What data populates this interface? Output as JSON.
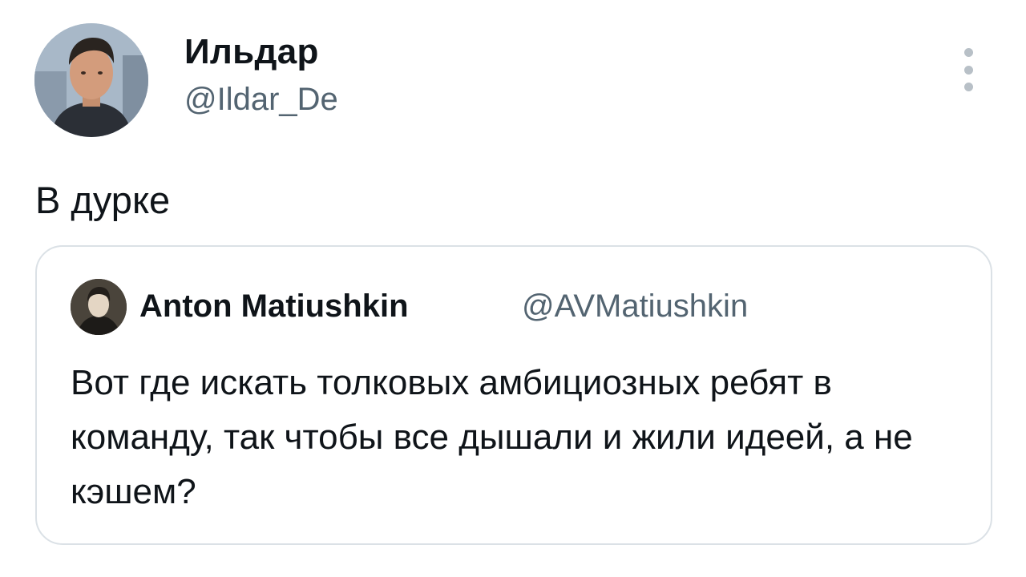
{
  "tweet": {
    "author": {
      "name": "Ильдар",
      "handle": "@Ildar_De"
    },
    "text": "В дурке",
    "more_icon": "more-vertical-icon"
  },
  "quoted_tweet": {
    "author": {
      "name": "Anton Matiushkin",
      "handle": "@AVMatiushkin"
    },
    "text": "Вот где искать толковых амбициозных ребят в команду, так чтобы все дышали и жили идеей, а не кэшем?"
  },
  "colors": {
    "text_primary": "#0f1419",
    "text_secondary": "#536471",
    "border": "#dbe1e6",
    "background": "#ffffff"
  }
}
